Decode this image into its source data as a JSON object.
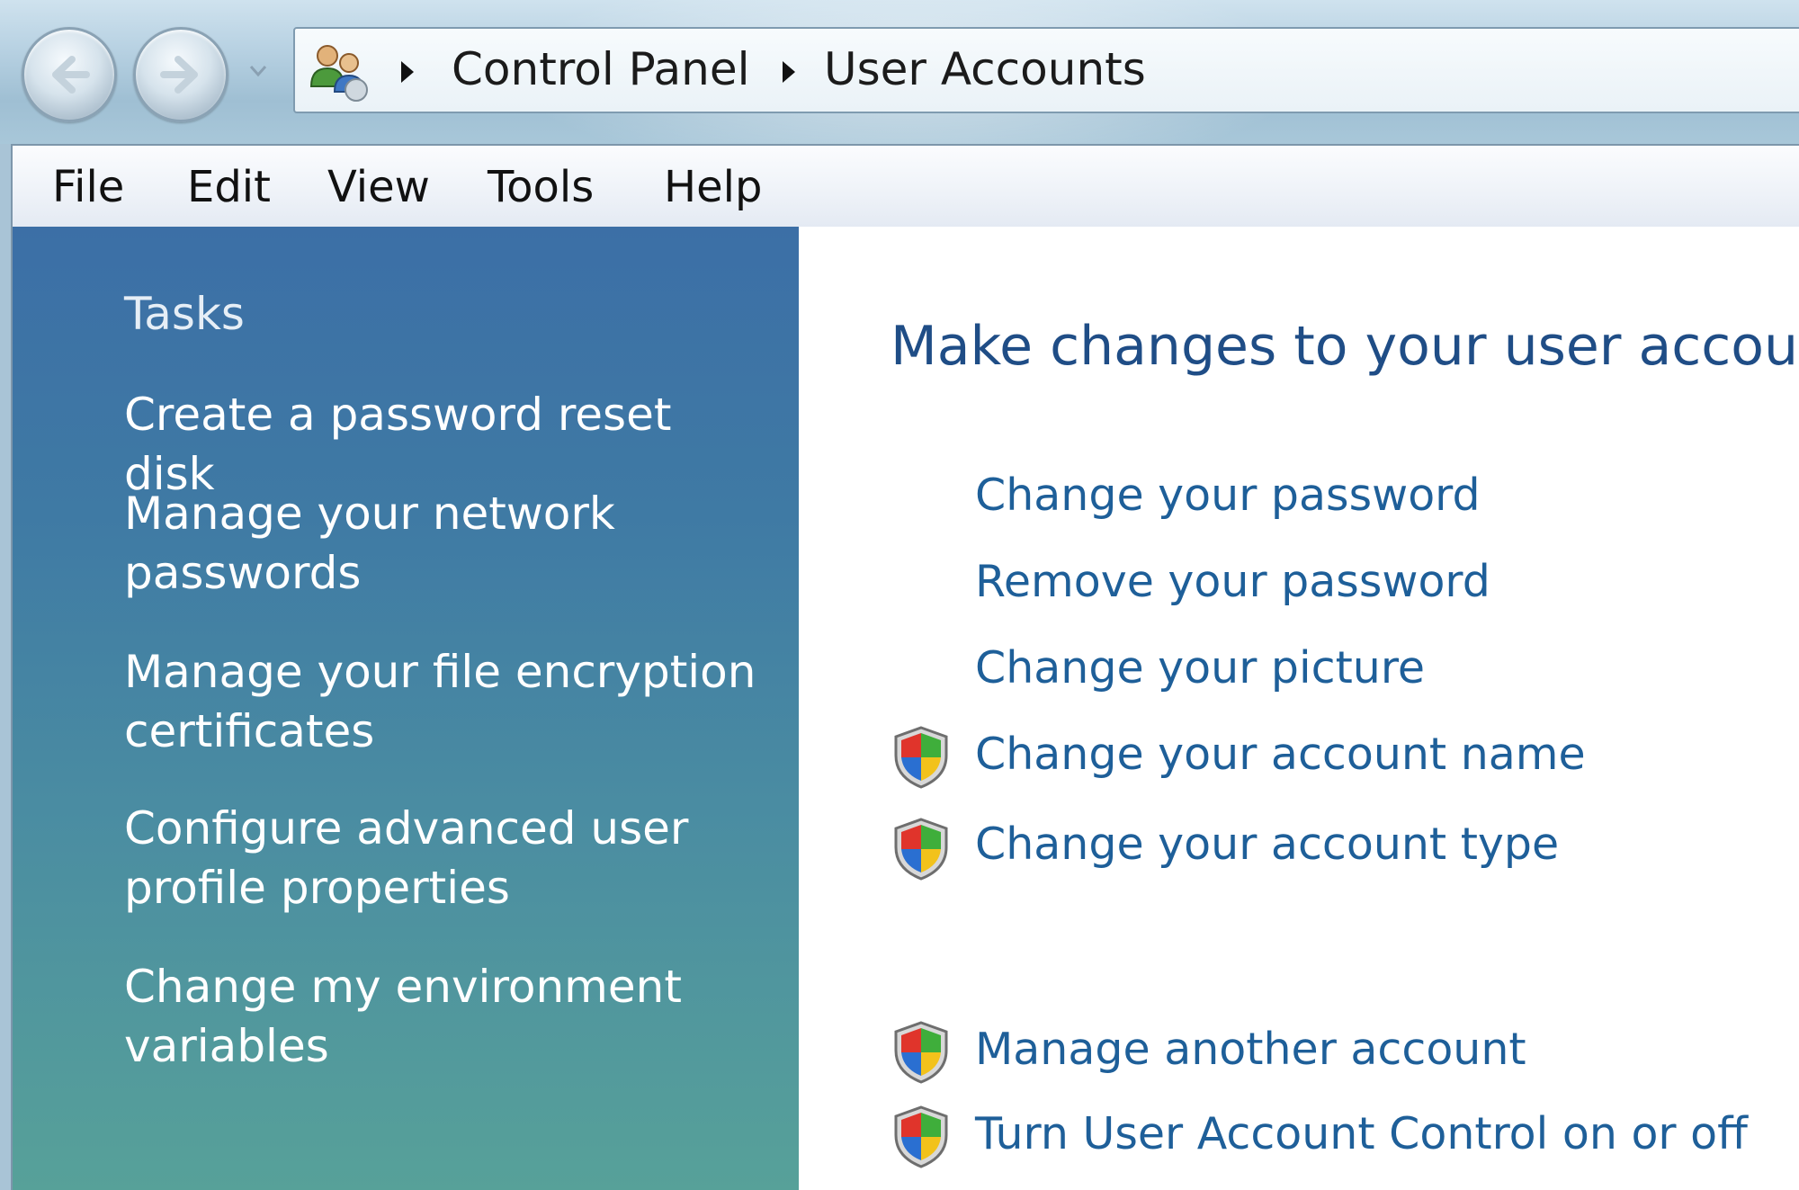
{
  "navigation": {
    "back_icon": "back-arrow-icon",
    "forward_icon": "forward-arrow-icon",
    "recent_icon": "chevron-down-icon"
  },
  "address_bar": {
    "icon": "user-accounts-icon",
    "breadcrumb": [
      "Control Panel",
      "User Accounts"
    ]
  },
  "menu": {
    "items": [
      "File",
      "Edit",
      "View",
      "Tools",
      "Help"
    ]
  },
  "sidebar": {
    "heading": "Tasks",
    "links": [
      "Create a password reset disk",
      "Manage your network passwords",
      "Manage your file encryption certificates",
      "Configure advanced user profile properties",
      "Change my environment variables"
    ]
  },
  "main": {
    "title": "Make changes to your user accou",
    "actions": [
      {
        "label": "Change your password",
        "icon": ""
      },
      {
        "label": "Remove your password",
        "icon": ""
      },
      {
        "label": "Change your picture",
        "icon": ""
      },
      {
        "label": "Change your account name",
        "icon": "uac-shield-icon"
      },
      {
        "label": "Change your account type",
        "icon": "uac-shield-icon"
      }
    ],
    "other_actions": [
      {
        "label": "Manage another account",
        "icon": "uac-shield-icon"
      },
      {
        "label": "Turn User Account Control on or off",
        "icon": "uac-shield-icon"
      }
    ]
  },
  "colors": {
    "sidebar_top": "#3c6fa6",
    "sidebar_bottom": "#57a199",
    "link_blue": "#1e5f99",
    "title_blue": "#1f4d86"
  }
}
